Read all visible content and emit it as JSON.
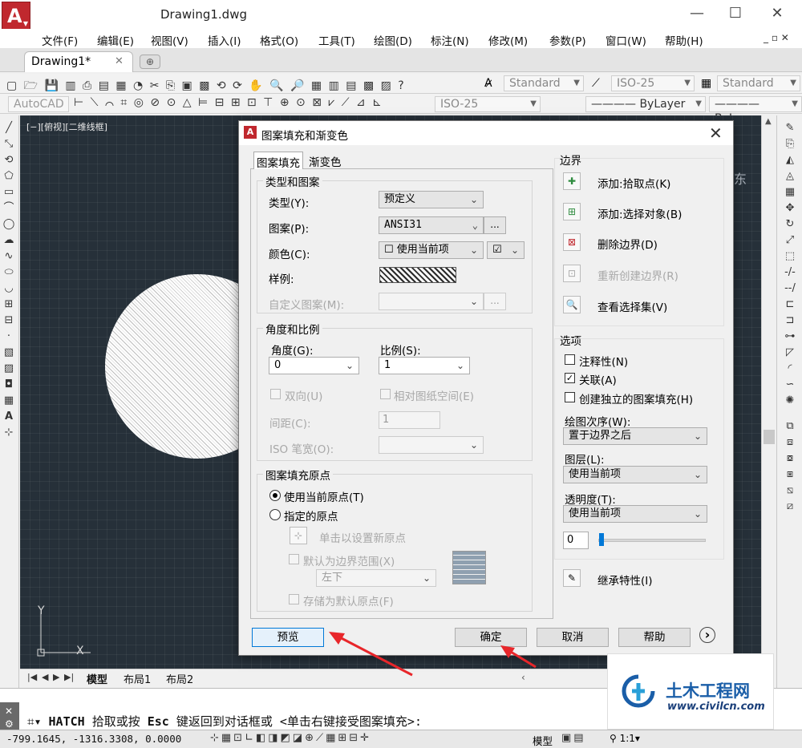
{
  "window": {
    "title": "Drawing1.dwg",
    "app_button_glyph": "A",
    "minimize": "—",
    "maximize": "☐",
    "close": "✕"
  },
  "menu": [
    "文件(F)",
    "编辑(E)",
    "视图(V)",
    "插入(I)",
    "格式(O)",
    "工具(T)",
    "绘图(D)",
    "标注(N)",
    "修改(M)",
    "参数(P)",
    "窗口(W)",
    "帮助(H)"
  ],
  "mdi_controls": "_ ▫ ✕",
  "tabs": {
    "document": "Drawing1*",
    "close": "✕",
    "new_tab": "⊕"
  },
  "toolbars": {
    "text_style": "Standard",
    "dim_style": "ISO-25",
    "table_style": "Standard",
    "workspace": "AutoCAD",
    "dim_style2": "ISO-25",
    "linetype": "———— ByLayer",
    "lineweight": "———— ByLayer"
  },
  "canvas": {
    "viewport_label": "[−][俯视][二维线框]",
    "compass_letter": "东",
    "ucs_x": "X",
    "ucs_y": "Y"
  },
  "layout_tabs": [
    "模型",
    "布局1",
    "布局2"
  ],
  "command_line": {
    "command": "HATCH",
    "prompt": " 拾取或按 ",
    "key": "Esc",
    "rest": " 键返回到对话框或 <单击右键接受图案填充>:"
  },
  "statusbar": {
    "coords": "-799.1645, -1316.3308, 0.0000",
    "model": "模型",
    "scale": "1:1"
  },
  "dialog": {
    "title": "图案填充和渐变色",
    "tabs": [
      "图案填充",
      "渐变色"
    ],
    "type_pattern": {
      "title": "类型和图案",
      "type_label": "类型(Y):",
      "type_value": "预定义",
      "pattern_label": "图案(P):",
      "pattern_value": "ANSI31",
      "browse": "...",
      "color_label": "颜色(C):",
      "color_value": "☐ 使用当前项",
      "bgcolor_value": "☑",
      "sample_label": "样例:",
      "custom_label": "自定义图案(M):"
    },
    "angle_scale": {
      "title": "角度和比例",
      "angle_label": "角度(G):",
      "angle_value": "0",
      "scale_label": "比例(S):",
      "scale_value": "1",
      "double_label": "双向(U)",
      "relative_label": "相对图纸空间(E)",
      "spacing_label": "间距(C):",
      "spacing_value": "1",
      "iso_label": "ISO 笔宽(O):"
    },
    "origin": {
      "title": "图案填充原点",
      "use_current": "使用当前原点(T)",
      "specified": "指定的原点",
      "click_set": "单击以设置新原点",
      "default_extents": "默认为边界范围(X)",
      "position_value": "左下",
      "store_default": "存储为默认原点(F)"
    },
    "boundaries": {
      "title": "边界",
      "add_pick": "添加:拾取点(K)",
      "add_select": "添加:选择对象(B)",
      "remove": "删除边界(D)",
      "recreate": "重新创建边界(R)",
      "view_selections": "查看选择集(V)"
    },
    "options": {
      "title": "选项",
      "annotative": "注释性(N)",
      "associative": "关联(A)",
      "associative_checked": "✓",
      "separate": "创建独立的图案填充(H)",
      "draw_order_label": "绘图次序(W):",
      "draw_order_value": "置于边界之后",
      "layer_label": "图层(L):",
      "layer_value": "使用当前项",
      "transparency_label": "透明度(T):",
      "transparency_value": "使用当前项",
      "transparency_amount": "0"
    },
    "inherit": "继承特性(I)",
    "buttons": {
      "preview": "预览",
      "ok": "确定",
      "cancel": "取消",
      "help": "帮助",
      "more": "›"
    }
  },
  "watermark": {
    "name": "土木工程网",
    "url": "www.civilcn.com"
  },
  "colors": {
    "canvas": "#263039",
    "annotation_arrow": "#e8262a",
    "brand_red": "#c0282e"
  }
}
